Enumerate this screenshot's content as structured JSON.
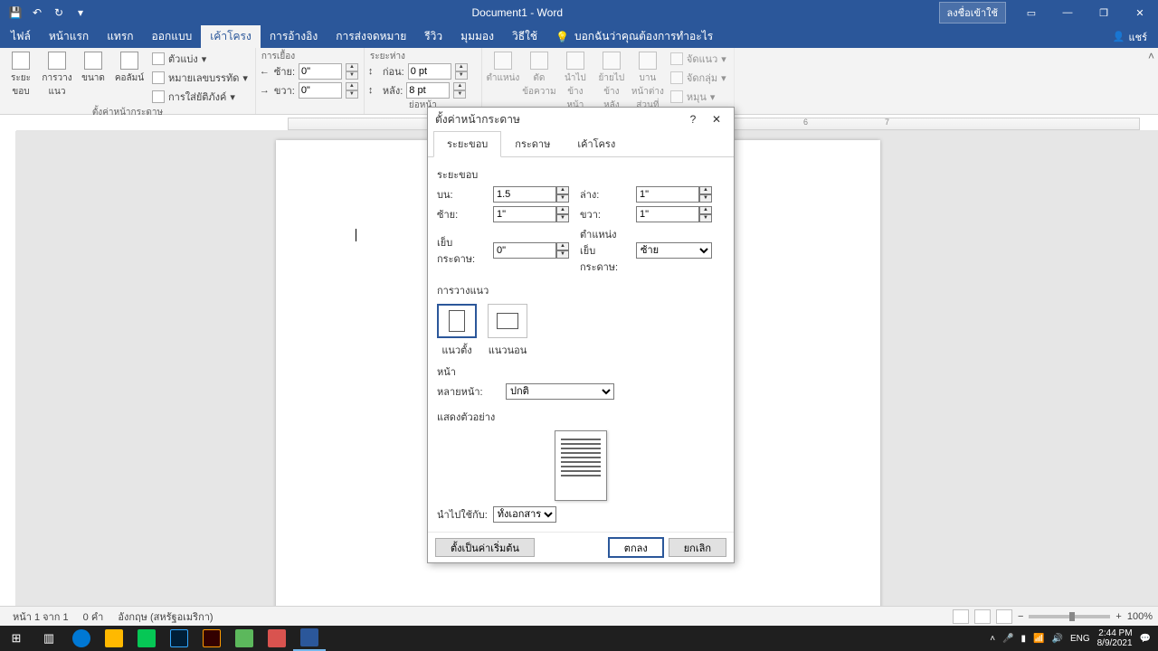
{
  "titlebar": {
    "title": "Document1 - Word",
    "signin": "ลงชื่อเข้าใช้"
  },
  "tabs": {
    "file": "ไฟล์",
    "home": "หน้าแรก",
    "insert": "แทรก",
    "design": "ออกแบบ",
    "layout": "เค้าโครง",
    "references": "การอ้างอิง",
    "mailings": "การส่งจดหมาย",
    "review": "รีวิว",
    "view": "มุมมอง",
    "help": "วิธีใช้",
    "tellme": "บอกฉันว่าคุณต้องการทำอะไร",
    "share": "แชร์"
  },
  "ribbon": {
    "g1": {
      "margins": "ระยะขอบ",
      "orientation": "การวางแนว",
      "size": "ขนาด",
      "columns": "คอลัมน์",
      "breaks": "ตัวแบ่ง",
      "lineNumbers": "หมายเลขบรรทัด",
      "hyphenation": "การใส่ยัติภังค์",
      "label": "ตั้งค่าหน้ากระดาษ"
    },
    "g2": {
      "title": "การเยื้อง",
      "left": "ซ้าย:",
      "leftVal": "0\"",
      "right": "ขวา:",
      "rightVal": "0\""
    },
    "g3": {
      "title": "ระยะห่าง",
      "before": "ก่อน:",
      "beforeVal": "0 pt",
      "after": "หลัง:",
      "afterVal": "8 pt",
      "label": "ย่อหน้า"
    },
    "g4": {
      "position": "ตำแหน่ง",
      "wrap": "ตัดข้อความ",
      "forward": "นำไปข้างหน้า",
      "backward": "ย้ายไปข้างหลัง",
      "selection": "บานหน้าต่างส่วนที่เลือก",
      "align": "จัดแนว",
      "group": "จัดกลุ่ม",
      "rotate": "หมุน"
    }
  },
  "dialog": {
    "title": "ตั้งค่าหน้ากระดาษ",
    "tabs": {
      "margins": "ระยะขอบ",
      "paper": "กระดาษ",
      "layout": "เค้าโครง"
    },
    "sections": {
      "margins": "ระยะขอบ",
      "orientation": "การวางแนว",
      "pages": "หน้า",
      "preview": "แสดงตัวอย่าง"
    },
    "labels": {
      "top": "บน:",
      "bottom": "ล่าง:",
      "left": "ซ้าย:",
      "right": "ขวา:",
      "gutter": "เย็บกระดาษ:",
      "gutterPos": "ตำแหน่งเย็บกระดาษ:",
      "portrait": "แนวตั้ง",
      "landscape": "แนวนอน",
      "multiplePages": "หลายหน้า:",
      "applyTo": "นำไปใช้กับ:"
    },
    "values": {
      "top": "1.5",
      "bottom": "1\"",
      "left": "1\"",
      "right": "1\"",
      "gutter": "0\"",
      "gutterPos": "ซ้าย",
      "multiplePages": "ปกติ",
      "applyTo": "ทั้งเอกสาร"
    },
    "buttons": {
      "default": "ตั้งเป็นค่าเริ่มต้น",
      "ok": "ตกลง",
      "cancel": "ยกเลิก"
    }
  },
  "statusbar": {
    "page": "หน้า 1 จาก 1",
    "words": "0 คำ",
    "lang": "อังกฤษ (สหรัฐอเมริกา)",
    "zoom": "100%"
  },
  "taskbar": {
    "lang": "ENG",
    "time": "2:44 PM",
    "date": "8/9/2021"
  },
  "ruler": {
    "n6": "6",
    "n7": "7"
  }
}
